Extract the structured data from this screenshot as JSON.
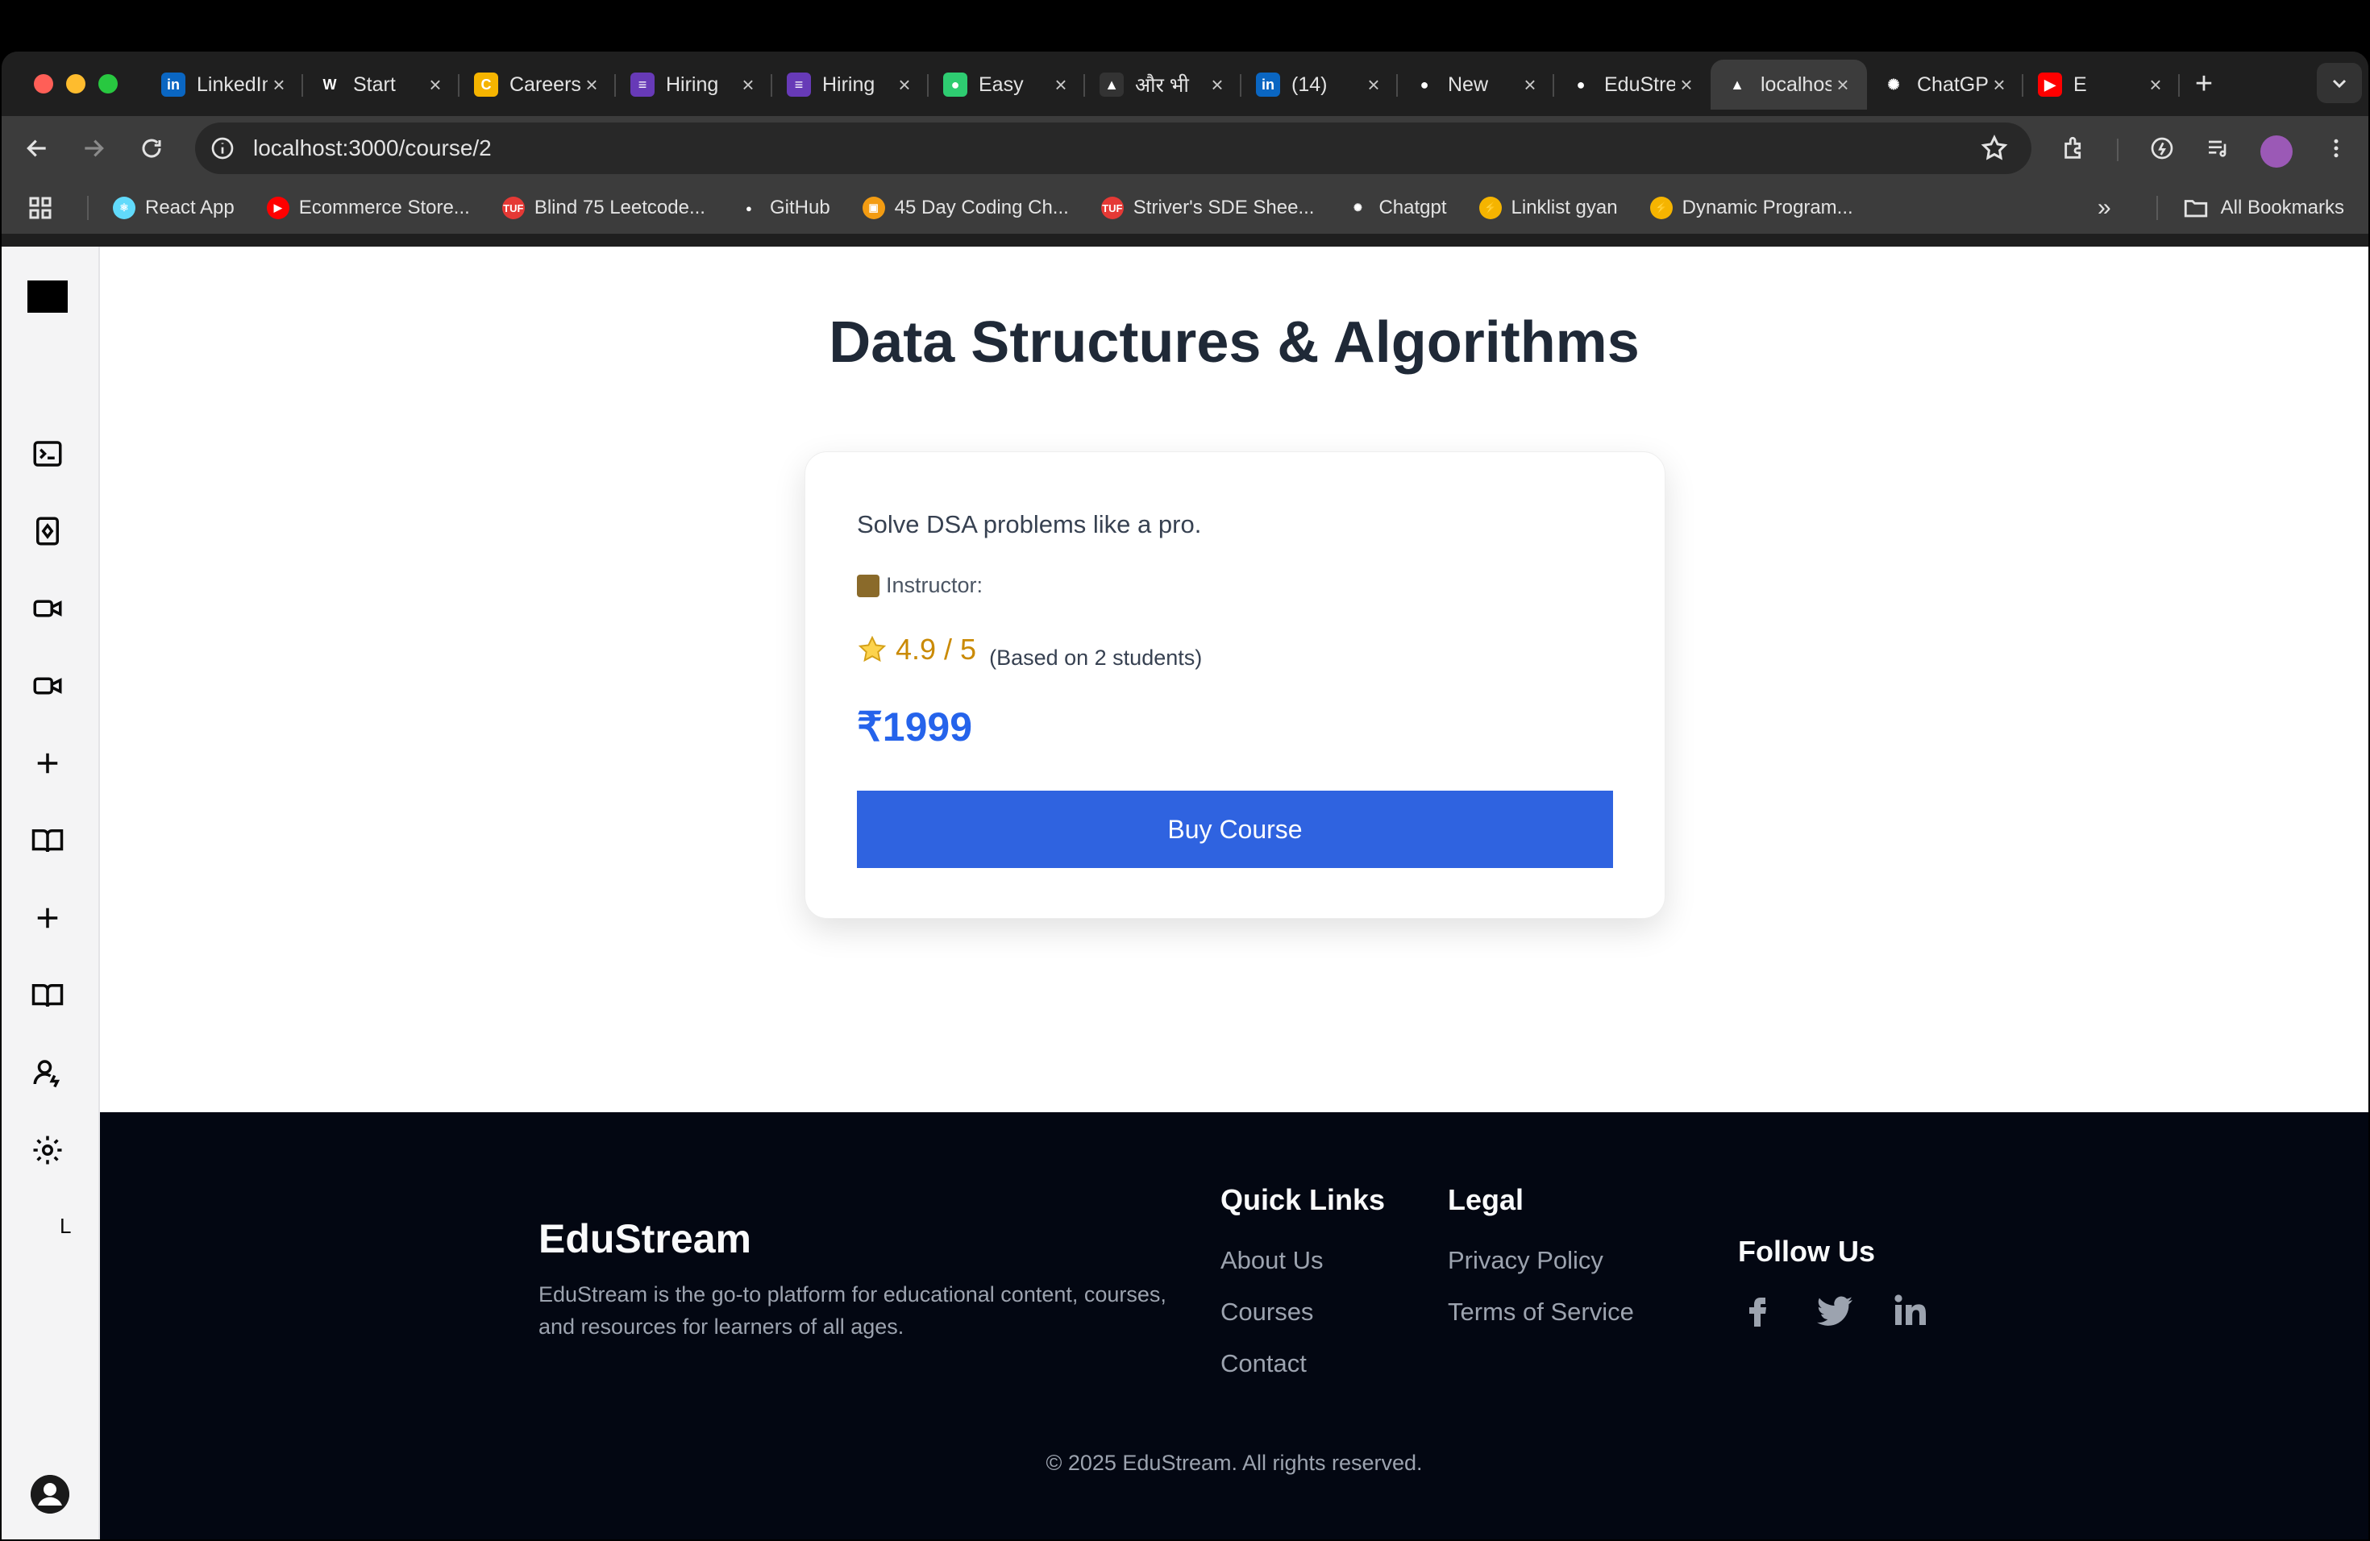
{
  "browser": {
    "tabs": [
      {
        "title": "LinkedIn",
        "favicon": "linkedin-icon",
        "color": "#0a66c2",
        "glyph": "in"
      },
      {
        "title": "Start",
        "favicon": "w-icon",
        "color": "#ffffff",
        "glyph": "W"
      },
      {
        "title": "Careers",
        "favicon": "careers-icon",
        "color": "#f5b400",
        "glyph": "C"
      },
      {
        "title": "Hiring",
        "favicon": "form-icon",
        "color": "#673ab7",
        "glyph": "≡"
      },
      {
        "title": "Hiring",
        "favicon": "form-icon",
        "color": "#673ab7",
        "glyph": "≡"
      },
      {
        "title": "Easy",
        "favicon": "easy-icon",
        "color": "#2ecc71",
        "glyph": "●"
      },
      {
        "title": "और भी",
        "favicon": "media-icon",
        "color": "#333333",
        "glyph": "▲"
      },
      {
        "title": "(14)",
        "favicon": "linkedin-icon",
        "color": "#0a66c2",
        "glyph": "in"
      },
      {
        "title": "New",
        "favicon": "github-icon",
        "color": "#ffffff",
        "glyph": "●"
      },
      {
        "title": "EduStream",
        "favicon": "github-icon",
        "color": "#ffffff",
        "glyph": "●"
      },
      {
        "title": "localhost",
        "favicon": "vercel-icon",
        "color": "#ffffff",
        "glyph": "▲",
        "active": true
      },
      {
        "title": "ChatGPT",
        "favicon": "chatgpt-icon",
        "color": "#ffffff",
        "glyph": "✺"
      },
      {
        "title": "E",
        "favicon": "youtube-icon",
        "color": "#ff0000",
        "glyph": "▶"
      }
    ],
    "url": "localhost:3000/course/2",
    "bookmarks": [
      {
        "label": "React App",
        "color": "#61dafb",
        "glyph": "⚛"
      },
      {
        "label": "Ecommerce Store...",
        "color": "#ff0000",
        "glyph": "▶"
      },
      {
        "label": "Blind 75 Leetcode...",
        "color": "#e53935",
        "glyph": "TUF"
      },
      {
        "label": "GitHub",
        "color": "#ffffff",
        "glyph": "●"
      },
      {
        "label": "45 Day Coding Ch...",
        "color": "#f39c12",
        "glyph": "▣"
      },
      {
        "label": "Striver's SDE Shee...",
        "color": "#e53935",
        "glyph": "TUF"
      },
      {
        "label": "Chatgpt",
        "color": "#ffffff",
        "glyph": "✺"
      },
      {
        "label": "Linklist gyan",
        "color": "#f5b400",
        "glyph": "⚡"
      },
      {
        "label": "Dynamic Program...",
        "color": "#f5b400",
        "glyph": "⚡"
      }
    ],
    "all_bookmarks": "All Bookmarks"
  },
  "sidebar": {
    "letter": "L"
  },
  "course": {
    "title": "Data Structures & Algorithms",
    "description": "Solve DSA problems like a pro.",
    "instructor_label": "Instructor:",
    "rating": "4.9 / 5",
    "rating_note": "(Based on 2 students)",
    "price": "₹1999",
    "buy_label": "Buy Course"
  },
  "footer": {
    "brand": "EduStream",
    "about": "EduStream is the go-to platform for educational content, courses, and resources for learners of all ages.",
    "quick_links_title": "Quick Links",
    "quick_links": [
      "About Us",
      "Courses",
      "Contact"
    ],
    "legal_title": "Legal",
    "legal_links": [
      "Privacy Policy",
      "Terms of Service"
    ],
    "follow_title": "Follow Us",
    "copyright": "© 2025 EduStream. All rights reserved."
  },
  "colors": {
    "accent": "#2f63e0",
    "price": "#2563eb",
    "rating": "#ca8a04",
    "footer_bg": "#030712"
  }
}
